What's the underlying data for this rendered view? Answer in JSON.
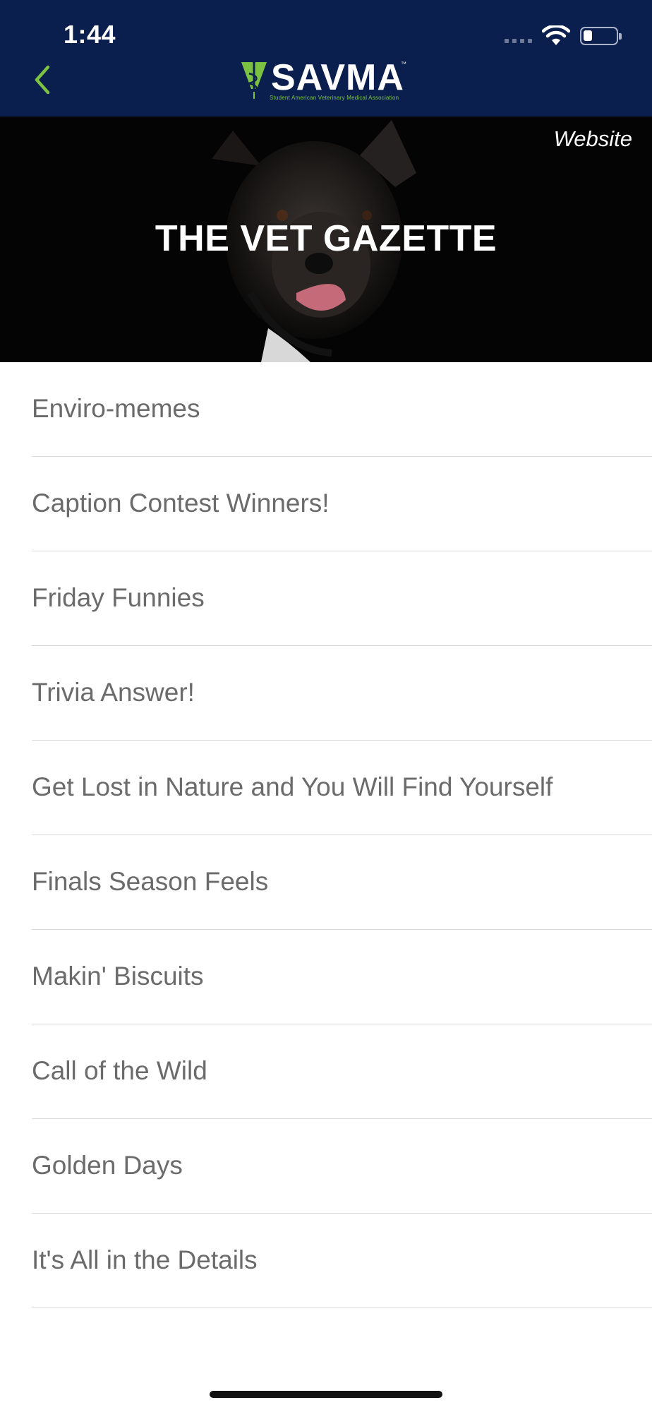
{
  "status_bar": {
    "time": "1:44"
  },
  "nav": {
    "back_icon": "chevron-left-icon",
    "logo_text": "SAVMA",
    "logo_trademark": "™",
    "logo_subtitle": "Student American Veterinary Medical Association"
  },
  "hero": {
    "title": "THE VET GAZETTE",
    "website_link": "Website"
  },
  "articles": [
    {
      "label": "Enviro-memes"
    },
    {
      "label": "Caption Contest Winners!"
    },
    {
      "label": "Friday Funnies"
    },
    {
      "label": "Trivia Answer!"
    },
    {
      "label": "Get Lost in Nature and You Will Find Yourself"
    },
    {
      "label": "Finals Season Feels"
    },
    {
      "label": "Makin' Biscuits"
    },
    {
      "label": "Call of the Wild"
    },
    {
      "label": "Golden Days"
    },
    {
      "label": "It's All in the Details"
    }
  ],
  "colors": {
    "nav_background": "#0a1f4e",
    "accent_green": "#7cc242",
    "list_text": "#6b6b6b",
    "divider": "#d9d9d9"
  }
}
